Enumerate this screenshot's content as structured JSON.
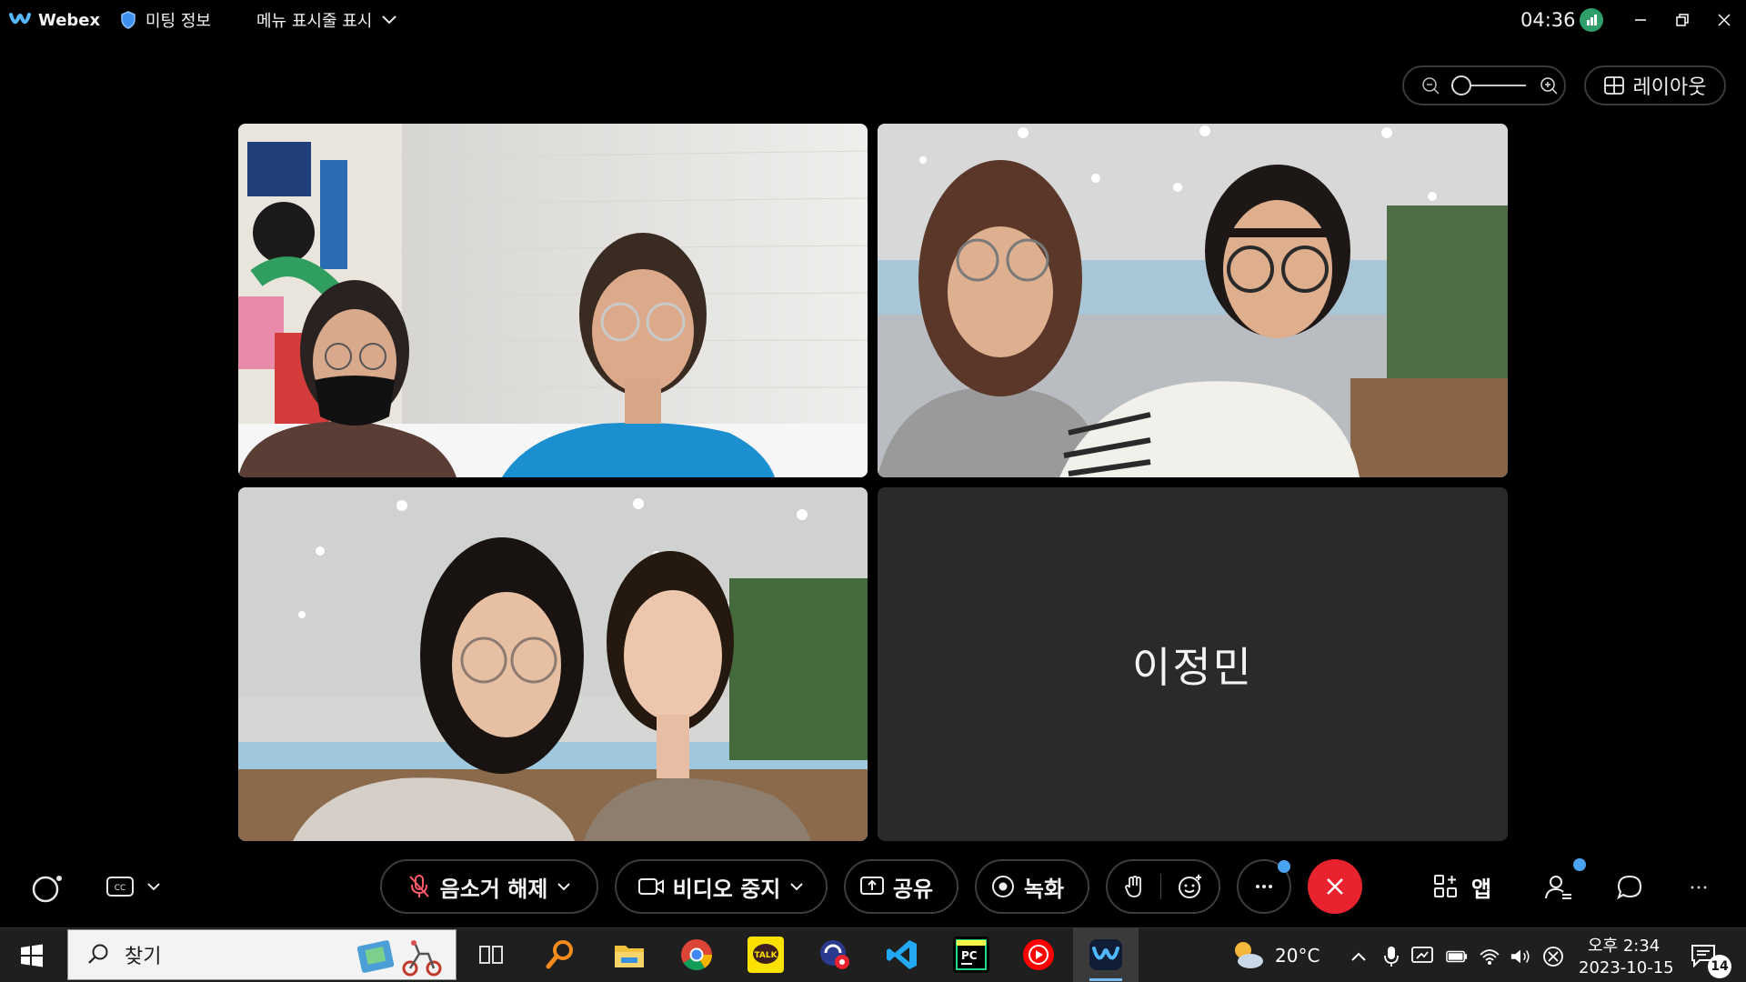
{
  "titlebar": {
    "brand": "Webex",
    "meeting_info": "미팅 정보",
    "menu_bar": "메뉴 표시줄 표시",
    "clock": "04:36",
    "icons": [
      "webex-logo-icon",
      "shield-icon",
      "chevron-down-icon",
      "network-health-icon",
      "minimize-icon",
      "restore-icon",
      "close-icon"
    ]
  },
  "view": {
    "zoom_level": 0,
    "layout_label": "레이아웃"
  },
  "participants": [
    {
      "kind": "video"
    },
    {
      "kind": "video"
    },
    {
      "kind": "video"
    },
    {
      "kind": "avatar",
      "name": "이정민"
    }
  ],
  "controls": {
    "unmute": "음소거 해제",
    "stop_video": "비디오 중지",
    "share": "공유",
    "record": "녹화",
    "apps": "앱",
    "more_dot_color": "#4aa3f0",
    "end_color": "#e8232f"
  },
  "taskbar": {
    "search_placeholder": "찾기",
    "weather_temp": "20°C",
    "time": "오후 2:34",
    "date": "2023-10-15",
    "notifications": "14",
    "apps": [
      "task-view-icon",
      "search-app-icon",
      "file-explorer-icon",
      "chrome-icon",
      "kakaotalk-icon",
      "app-icon",
      "vscode-icon",
      "pycharm-icon",
      "youtube-music-icon",
      "webex-taskbar-icon"
    ],
    "kakao_badge": "TALK",
    "pycharm_badge": "PC"
  }
}
